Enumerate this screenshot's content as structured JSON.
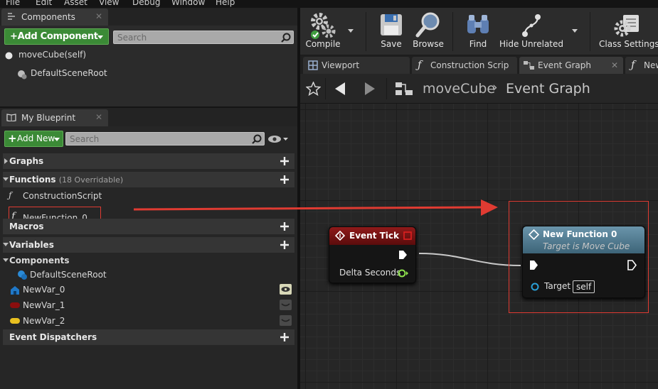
{
  "menu": [
    "File",
    "Edit",
    "Asset",
    "View",
    "Debug",
    "Window",
    "Help"
  ],
  "components_panel": {
    "tab_label": "Components",
    "add_button": "+Add Component",
    "search_placeholder": "Search",
    "self_item": "moveCube(self)",
    "root_item": "DefaultSceneRoot"
  },
  "my_blueprint": {
    "tab_label": "My Blueprint",
    "add_button": "Add New",
    "search_placeholder": "Search",
    "graphs_label": "Graphs",
    "functions_label": "Functions",
    "functions_sub": "(18 Overridable)",
    "functions": [
      "ConstructionScript",
      "NewFunction_0"
    ],
    "macros_label": "Macros",
    "variables_label": "Variables",
    "components_label": "Components",
    "component_items": [
      "DefaultSceneRoot"
    ],
    "variables": [
      "NewVar_0",
      "NewVar_1",
      "NewVar_2"
    ],
    "dispatchers_label": "Event Dispatchers"
  },
  "toolbar": {
    "compile": "Compile",
    "save": "Save",
    "browse": "Browse",
    "find": "Find",
    "hide_unrelated": "Hide Unrelated",
    "class_settings": "Class Settings"
  },
  "doc_tabs": [
    "Viewport",
    "Construction Scrip",
    "Event Graph",
    "New"
  ],
  "breadcrumb": {
    "blueprint": "moveCube",
    "graph": "Event Graph"
  },
  "nodes": {
    "event_tick": {
      "title": "Event Tick",
      "pin_delta": "Delta Seconds"
    },
    "new_function": {
      "title": "New Function 0",
      "subtitle": "Target is Move Cube",
      "pin_target": "Target",
      "target_default": "self"
    }
  },
  "colors": {
    "annotation_red": "#e03b32",
    "add_green": "#3b8a36",
    "event_header": "#7a1414",
    "function_header": "#4a7488",
    "exec_pin": "#ffffff",
    "float_pin": "#8ee24d",
    "object_pin": "#2a9fd6"
  }
}
